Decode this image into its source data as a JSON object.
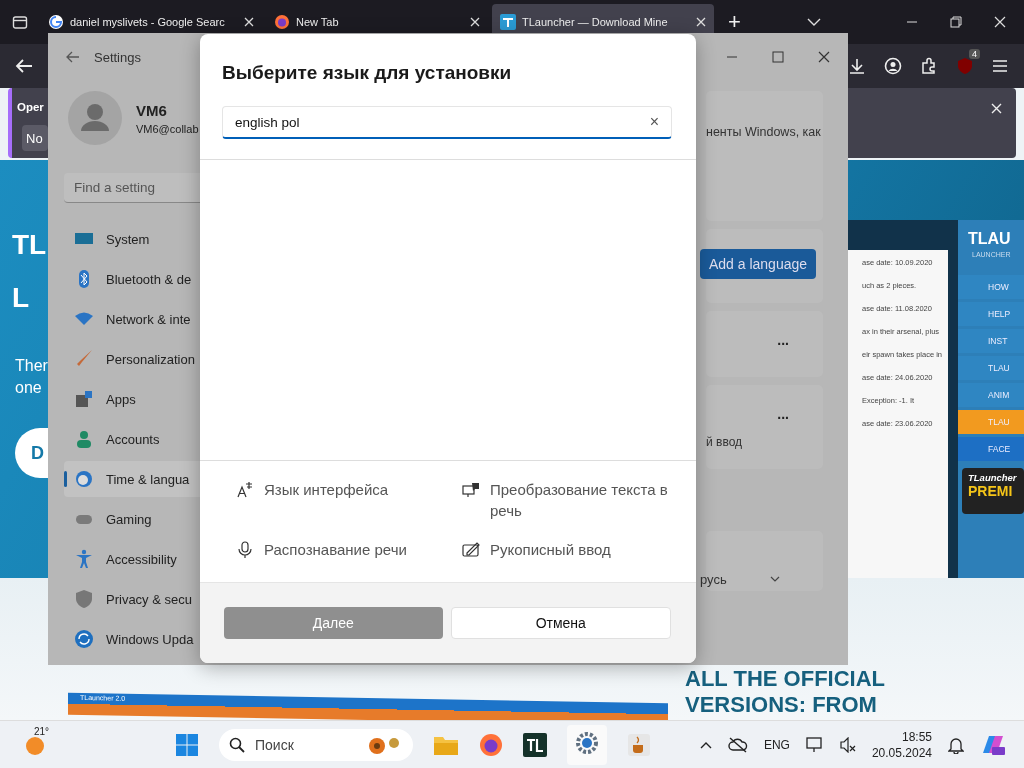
{
  "browser": {
    "tabs": [
      {
        "title": "daniel myslivets - Google Searc",
        "selected": false
      },
      {
        "title": "New Tab",
        "selected": false
      },
      {
        "title": "TLauncher — Download Mine",
        "selected": true
      }
    ],
    "new_tab": "+",
    "extension_badge": "4",
    "notification": {
      "title": "Oper",
      "button": "No"
    }
  },
  "page": {
    "hero_lines": [
      "TL",
      "L"
    ],
    "hero_text": [
      "Ther",
      "one"
    ],
    "download_button": "D",
    "screenshot": {
      "entries": [
        "ase date: 10.09.2020",
        "uch as 2 pieces.",
        "ase date: 11.08.2020",
        "ax in their arsenal, plus",
        "eir spawn takes place in",
        "ase date: 24.06.2020",
        "Exception: -1. It",
        "ase date: 23.06.2020"
      ],
      "logo": "TLAU",
      "logo_sub": "LAUNCHER",
      "menu": [
        {
          "label": "HOW",
          "kind": "plain"
        },
        {
          "label": "HELP",
          "kind": "plain"
        },
        {
          "label": "INST",
          "kind": "plain"
        },
        {
          "label": "TLAU",
          "kind": "plain"
        },
        {
          "label": "ANIM",
          "kind": "plain"
        },
        {
          "label": "TLAU",
          "kind": "orange"
        },
        {
          "label": "FACE",
          "kind": "blue"
        }
      ],
      "premium": [
        "TLauncher",
        "PREMI"
      ]
    },
    "banner_title": "TLauncher 2.0",
    "headline_lines": [
      "ALL THE OFFICIAL",
      "VERSIONS: FROM"
    ]
  },
  "settings": {
    "title": "Settings",
    "user": {
      "name": "VM6",
      "email": "VM6@collab"
    },
    "search_placeholder": "Find a setting",
    "nav": [
      {
        "label": "System",
        "selected": false
      },
      {
        "label": "Bluetooth & de",
        "selected": false
      },
      {
        "label": "Network & inte",
        "selected": false
      },
      {
        "label": "Personalization",
        "selected": false
      },
      {
        "label": "Apps",
        "selected": false
      },
      {
        "label": "Accounts",
        "selected": false
      },
      {
        "label": "Time & langua",
        "selected": true
      },
      {
        "label": "Gaming",
        "selected": false
      },
      {
        "label": "Accessibility",
        "selected": false
      },
      {
        "label": "Privacy & secu",
        "selected": false
      },
      {
        "label": "Windows Upda",
        "selected": false
      }
    ],
    "card_text": "ненты Windows, как",
    "add_language": "Add a language",
    "more": [
      "...",
      "..."
    ],
    "card_input_text": "й ввод",
    "region_value": "русь"
  },
  "dialog": {
    "title": "Выберите язык для установки",
    "search_value": "english pol",
    "clear": "×",
    "features": [
      "Язык интерфейса",
      "Преобразование текста в речь",
      "Распознавание речи",
      "Рукописный ввод"
    ],
    "next": {
      "label": "Далее",
      "disabled": true
    },
    "cancel": "Отмена"
  },
  "taskbar": {
    "temperature": "21°",
    "search_placeholder": "Поиск",
    "language": "ENG",
    "time": "18:55",
    "date": "20.05.2024"
  }
}
